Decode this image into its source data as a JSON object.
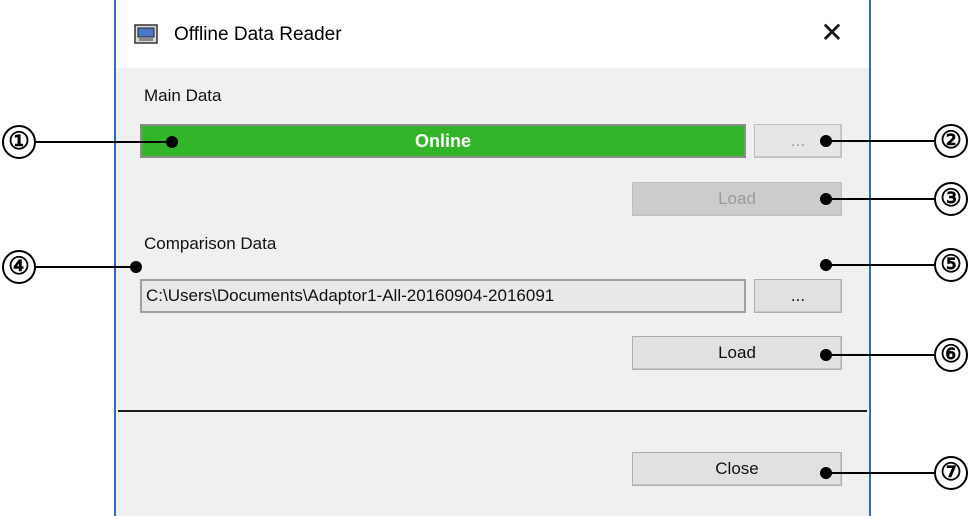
{
  "window": {
    "title": "Offline Data Reader",
    "close_glyph": "✕"
  },
  "main_data": {
    "label": "Main Data",
    "status": "Online",
    "status_color": "#33b52a",
    "browse_label": "...",
    "load_label": "Load"
  },
  "comparison_data": {
    "label": "Comparison Data",
    "path": "C:\\Users\\Documents\\Adaptor1-All-20160904-2016091",
    "browse_label": "...",
    "load_label": "Load"
  },
  "footer": {
    "close_label": "Close"
  },
  "callouts": [
    "①",
    "②",
    "③",
    "④",
    "⑤",
    "⑥",
    "⑦"
  ]
}
